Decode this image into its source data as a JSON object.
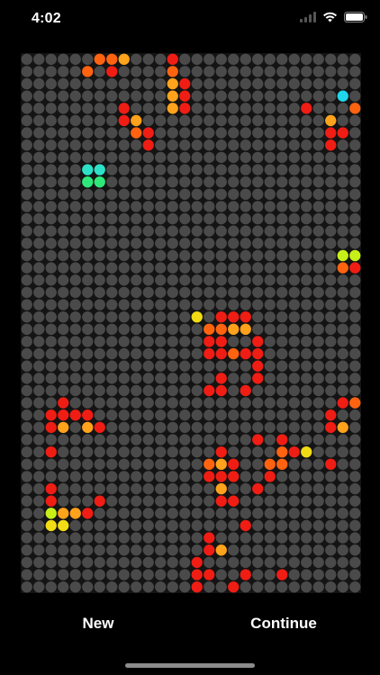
{
  "status_bar": {
    "time": "4:02",
    "icons": [
      "cellular-signal-icon",
      "wifi-icon",
      "battery-icon"
    ]
  },
  "board": {
    "columns": 28,
    "rows": 44,
    "empty_color": "#4a4a4a",
    "background": "#141414",
    "palette": {
      "R": "#ef1d14",
      "O": "#ff6310",
      "A": "#ffa21c",
      "Y": "#f2dc14",
      "L": "#c6f018",
      "G": "#2ee87a",
      "C": "#2de0c8",
      "S": "#20d6ea",
      "B": "#2350ff",
      "b": "#1f7dff",
      "P": "#ff1f55"
    },
    "grid": [
      "......OOA...R...............",
      ".....O.R....O...............",
      "............AR..............",
      "............AR............S.",
      "........R...AR.........R...O",
      "........RA...............A..",
      ".........OR..............RR.",
      "..........R..............R..",
      "............................",
      ".....CC.....................",
      ".....GG.....................",
      "............................",
      "............................",
      "............................",
      "............................",
      "............................",
      "..........................LL",
      "..........................OR",
      "............................",
      "............................",
      "............................",
      "..............Y.RRR.........",
      "...............OOAA.........",
      "...............RR..R........",
      "...............RRORR........",
      "...................R........",
      "................R..R........",
      "...............RR.R.........",
      "...R......................RO",
      "..RRRR...................R..",
      "..RA.AR..................RA.",
      "...................R.R......",
      "..R.............R....ORY....",
      "...............OAR..OO...R..",
      "...............RRR..R.......",
      "..R.............A..R........",
      "..R...R.........RR..........",
      "..LAAR......................",
      "..YY..............R.........",
      "...............R.............",
      "...............RA............",
      "..............R..............",
      "..............RR..R..R.......",
      "..............R..R..........."
    ]
  },
  "controls": {
    "new_label": "New",
    "continue_label": "Continue"
  }
}
